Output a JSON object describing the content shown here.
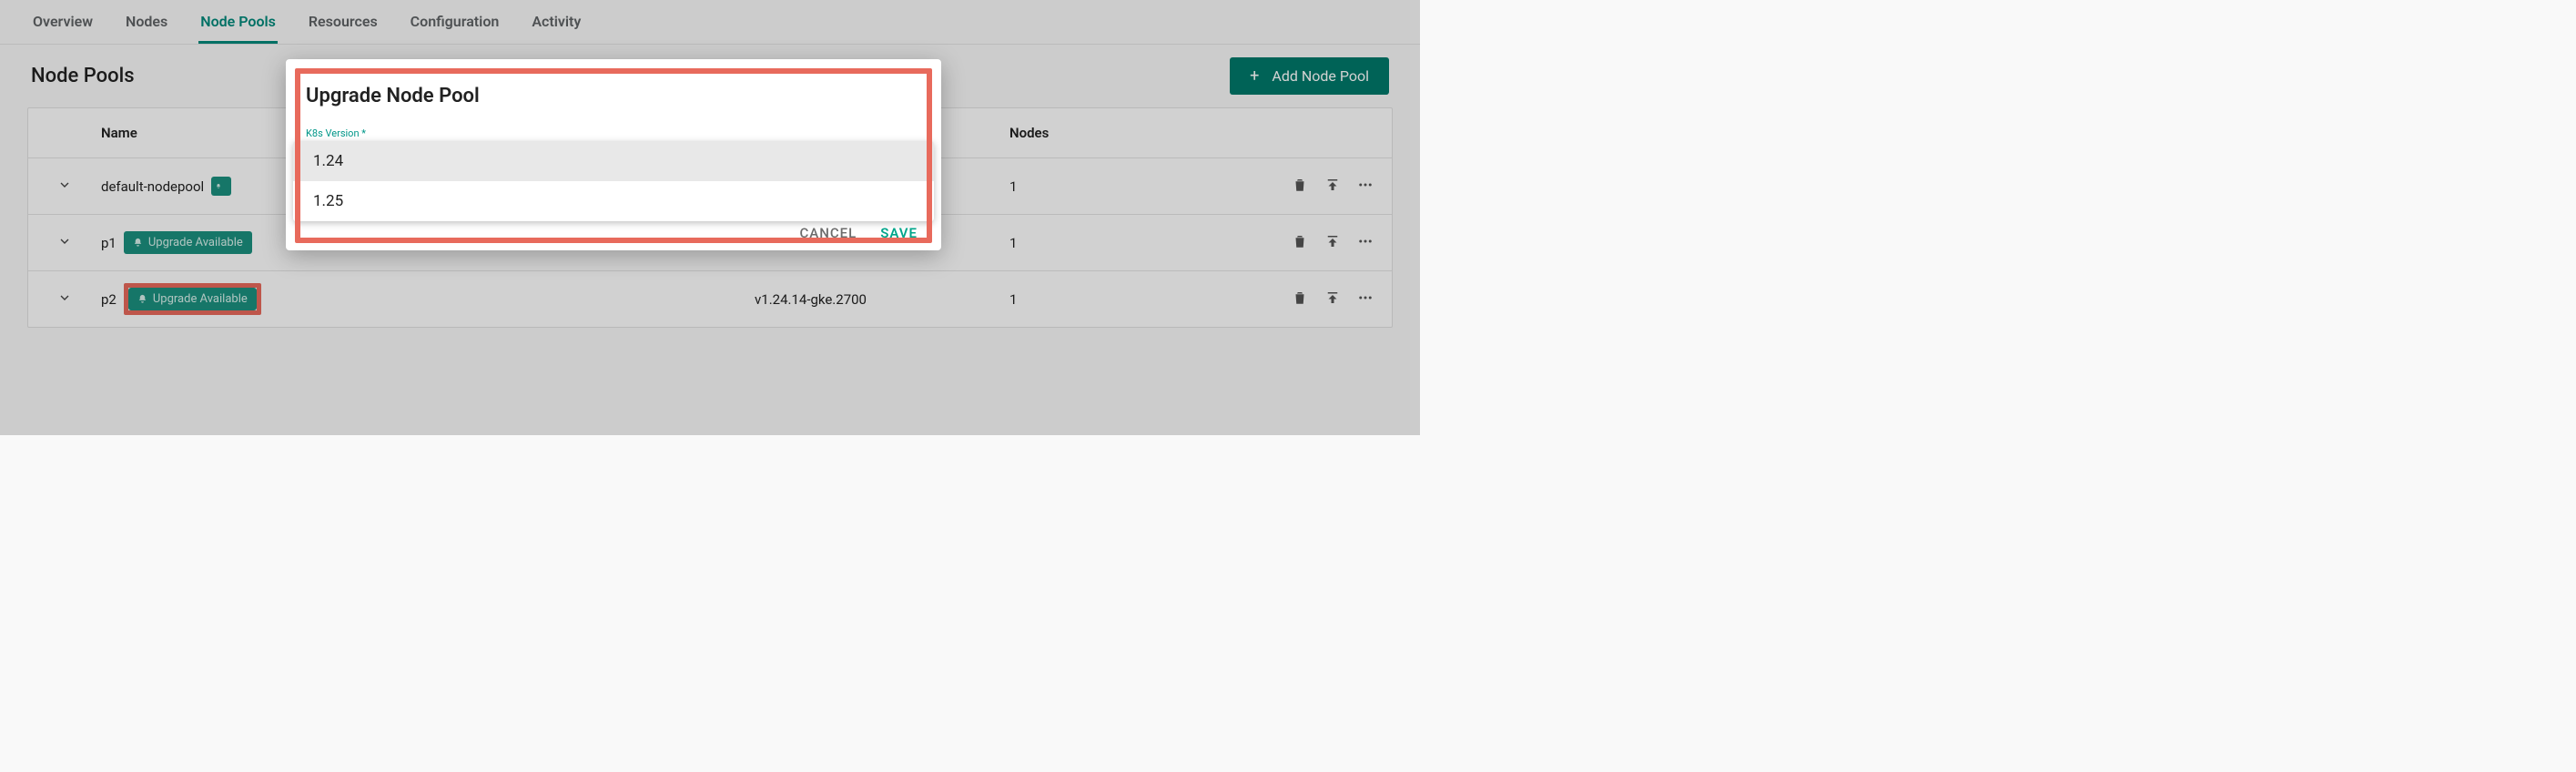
{
  "tabs": {
    "items": [
      {
        "label": "Overview"
      },
      {
        "label": "Nodes"
      },
      {
        "label": "Node Pools"
      },
      {
        "label": "Resources"
      },
      {
        "label": "Configuration"
      },
      {
        "label": "Activity"
      }
    ],
    "active_index": 2
  },
  "title_row": {
    "page_title": "Node Pools",
    "add_button_label": "Add Node Pool"
  },
  "table": {
    "columns": {
      "name": "Name",
      "version": "",
      "nodes": "Nodes"
    },
    "rows": [
      {
        "name": "default-nodepool",
        "upgrade_badge": "",
        "badge_narrow": true,
        "version": "",
        "nodes": "1",
        "highlight": false
      },
      {
        "name": "p1",
        "upgrade_badge": "Upgrade Available",
        "badge_narrow": false,
        "version": "",
        "nodes": "1",
        "highlight": false
      },
      {
        "name": "p2",
        "upgrade_badge": "Upgrade Available",
        "badge_narrow": false,
        "version": "v1.24.14-gke.2700",
        "nodes": "1",
        "highlight": true
      }
    ]
  },
  "modal": {
    "title": "Upgrade Node Pool",
    "field_label": "K8s Version *",
    "options": [
      "1.24",
      "1.25"
    ],
    "selected_index": 0,
    "cancel_label": "CANCEL",
    "save_label": "SAVE"
  },
  "colors": {
    "accent": "#00897b",
    "highlight_border": "#e86a5c"
  }
}
